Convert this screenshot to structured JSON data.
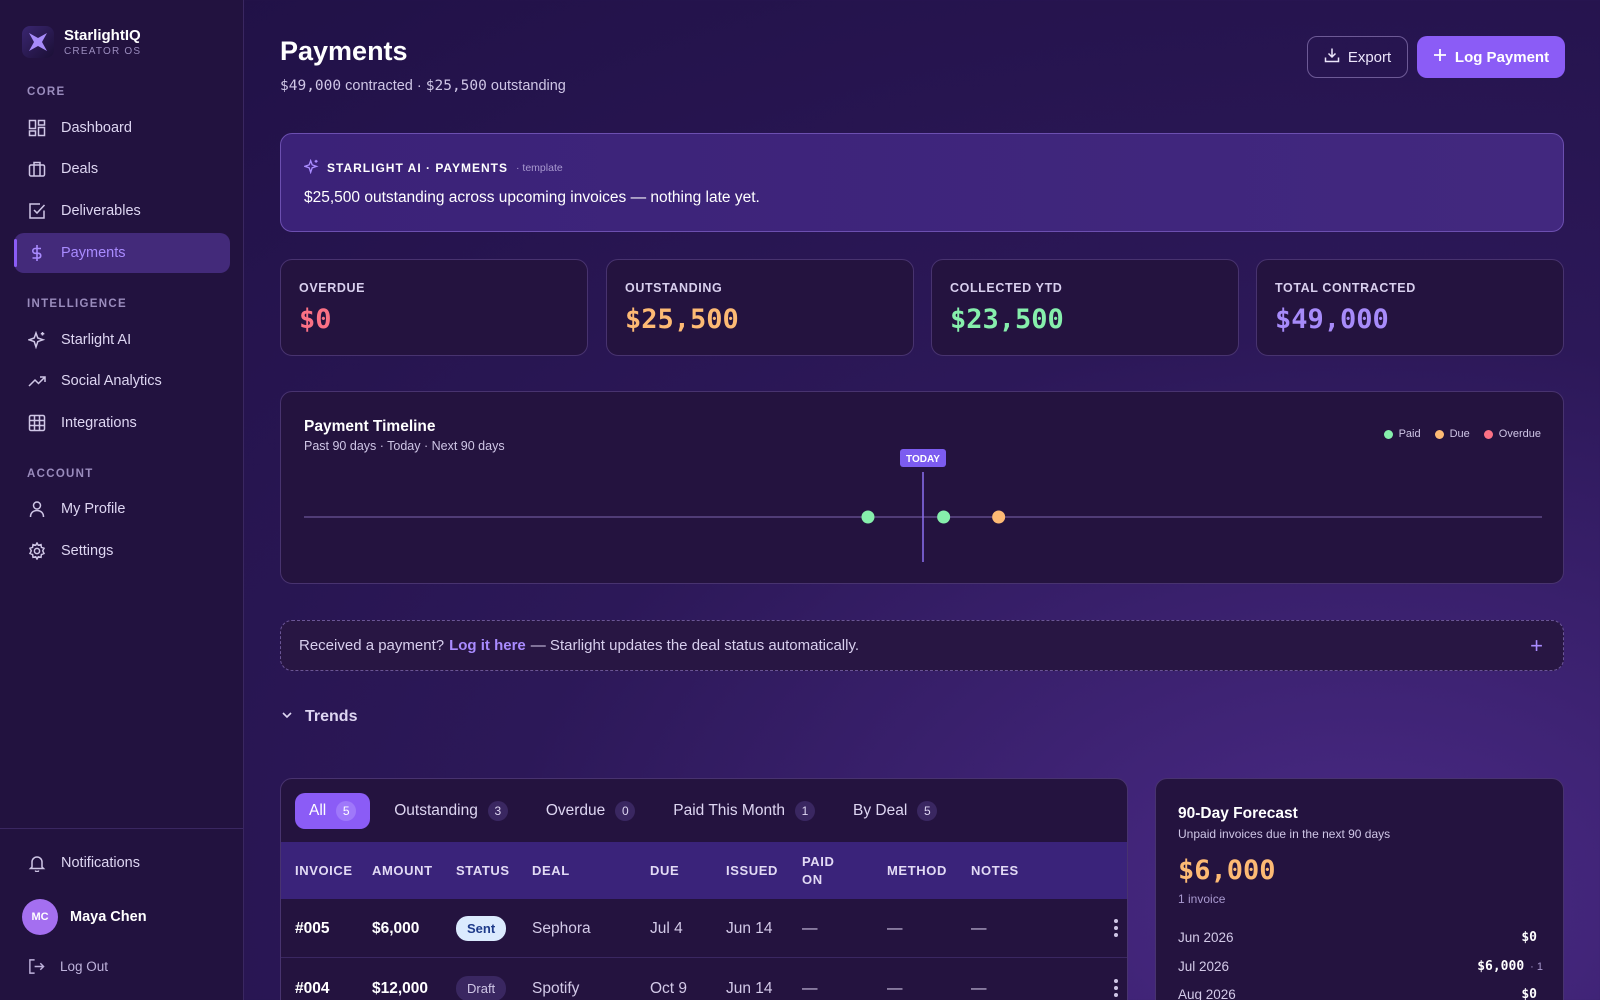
{
  "brand": {
    "name": "StarlightIQ",
    "subtitle": "CREATOR OS"
  },
  "sidebar": {
    "sections": [
      {
        "label": "CORE"
      },
      {
        "label": "INTELLIGENCE"
      },
      {
        "label": "ACCOUNT"
      }
    ],
    "items": [
      {
        "label": "Dashboard",
        "icon": "dashboard-icon"
      },
      {
        "label": "Deals",
        "icon": "briefcase-icon"
      },
      {
        "label": "Deliverables",
        "icon": "checkbox-icon"
      },
      {
        "label": "Payments",
        "icon": "dollar-icon",
        "active": true
      },
      {
        "label": "Starlight AI",
        "icon": "sparkle-icon"
      },
      {
        "label": "Social Analytics",
        "icon": "trend-up-icon"
      },
      {
        "label": "Integrations",
        "icon": "grid-icon"
      },
      {
        "label": "My Profile",
        "icon": "user-icon"
      },
      {
        "label": "Settings",
        "icon": "gear-icon"
      }
    ],
    "notifications_label": "Notifications",
    "user": {
      "initials": "MC",
      "name": "Maya Chen"
    },
    "logout_label": "Log Out"
  },
  "header": {
    "title": "Payments",
    "subtitle_contracted": "$49,000",
    "subtitle_contracted_suffix": "contracted ·",
    "subtitle_outstanding": "$25,500",
    "subtitle_outstanding_suffix": "outstanding",
    "export_label": "Export",
    "log_payment_label": "Log Payment"
  },
  "ai_card": {
    "heading": "STARLIGHT AI · PAYMENTS",
    "tag": "· template",
    "message": "$25,500 outstanding across upcoming invoices — nothing late yet."
  },
  "stats": [
    {
      "label": "OVERDUE",
      "value": "$0",
      "color": "#fb7185"
    },
    {
      "label": "OUTSTANDING",
      "value": "$25,500",
      "color": "#fdba74"
    },
    {
      "label": "COLLECTED YTD",
      "value": "$23,500",
      "color": "#86efac"
    },
    {
      "label": "TOTAL CONTRACTED",
      "value": "$49,000",
      "color": "#a78bfa"
    }
  ],
  "timeline": {
    "title": "Payment Timeline",
    "subtitle": "Past 90 days · Today · Next 90 days",
    "today_label": "TODAY",
    "legend": [
      {
        "label": "Paid",
        "color": "#86efac"
      },
      {
        "label": "Due",
        "color": "#fdba74"
      },
      {
        "label": "Overdue",
        "color": "#fb7185"
      }
    ],
    "range_days": [
      -90,
      90
    ],
    "points": [
      {
        "day": -8,
        "status": "paid"
      },
      {
        "day": 3,
        "status": "paid"
      },
      {
        "day": 11,
        "status": "due"
      }
    ]
  },
  "log_strip": {
    "prefix": "Received a payment?",
    "link": "Log it here",
    "suffix": "— Starlight updates the deal status automatically."
  },
  "trends_label": "Trends",
  "tabs": [
    {
      "label": "All",
      "count": "5",
      "active": true
    },
    {
      "label": "Outstanding",
      "count": "3"
    },
    {
      "label": "Overdue",
      "count": "0"
    },
    {
      "label": "Paid This Month",
      "count": "1"
    },
    {
      "label": "By Deal",
      "count": "5"
    }
  ],
  "table": {
    "columns": [
      "INVOICE",
      "AMOUNT",
      "STATUS",
      "DEAL",
      "DUE",
      "ISSUED",
      "PAID ON",
      "METHOD",
      "NOTES"
    ],
    "rows": [
      {
        "invoice": "#005",
        "amount": "$6,000",
        "status": "Sent",
        "deal": "Sephora",
        "due": "Jul 4",
        "issued": "Jun 14",
        "paid_on": "—",
        "method": "—",
        "notes": "—"
      },
      {
        "invoice": "#004",
        "amount": "$12,000",
        "status": "Draft",
        "deal": "Spotify",
        "due": "Oct 9",
        "issued": "Jun 14",
        "paid_on": "—",
        "method": "—",
        "notes": "—"
      }
    ]
  },
  "forecast": {
    "title": "90-Day Forecast",
    "subtitle": "Unpaid invoices due in the next 90 days",
    "value": "$6,000",
    "count": "1 invoice",
    "months": [
      {
        "month": "Jun 2026",
        "amount": "$0",
        "n": ""
      },
      {
        "month": "Jul 2026",
        "amount": "$6,000",
        "n": "· 1"
      },
      {
        "month": "Aug 2026",
        "amount": "$0",
        "n": ""
      }
    ]
  }
}
